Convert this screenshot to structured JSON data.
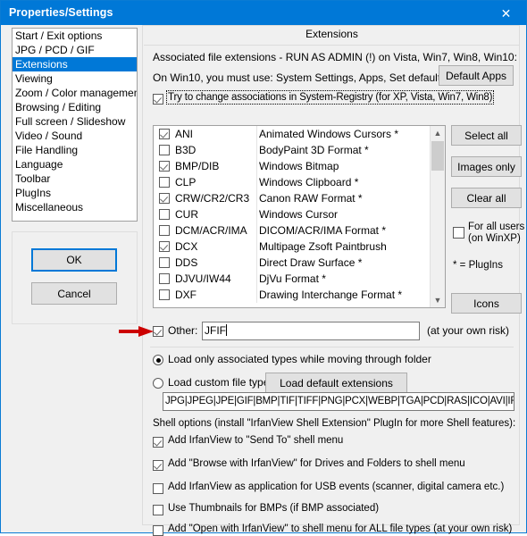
{
  "window": {
    "title": "Properties/Settings",
    "close_icon": "close-icon",
    "titlebar_color": "#0078d7",
    "accent_color": "#0078d7"
  },
  "sidebar": {
    "items": [
      {
        "label": "Start / Exit options",
        "selected": false
      },
      {
        "label": "JPG / PCD / GIF",
        "selected": false
      },
      {
        "label": "Extensions",
        "selected": true
      },
      {
        "label": "Viewing",
        "selected": false
      },
      {
        "label": "Zoom / Color management",
        "selected": false
      },
      {
        "label": "Browsing / Editing",
        "selected": false
      },
      {
        "label": "Full screen / Slideshow",
        "selected": false
      },
      {
        "label": "Video / Sound",
        "selected": false
      },
      {
        "label": "File Handling",
        "selected": false
      },
      {
        "label": "Language",
        "selected": false
      },
      {
        "label": "Toolbar",
        "selected": false
      },
      {
        "label": "PlugIns",
        "selected": false
      },
      {
        "label": "Miscellaneous",
        "selected": false
      }
    ],
    "buttons": {
      "ok": "OK",
      "cancel": "Cancel"
    }
  },
  "panel": {
    "group_title": "Extensions",
    "line1": "Associated file extensions - RUN AS ADMIN (!) on Vista, Win7, Win8, Win10:",
    "line2": "On Win10, you must use: System Settings, Apps, Set default apps !",
    "default_apps_button": "Default Apps",
    "registry_checkbox": {
      "label": "Try to change associations in System-Registry (for XP, Vista, Win7, Win8)",
      "checked": true
    },
    "side_buttons": {
      "select_all": "Select all",
      "images_only": "Images only",
      "clear_all": "Clear all",
      "icons": "Icons"
    },
    "all_users_checkbox": {
      "line1": "For all users",
      "line2": "(on WinXP)",
      "checked": false
    },
    "plugins_note": "* = PlugIns",
    "extensions": [
      {
        "ext": "ANI",
        "desc": "Animated Windows Cursors *",
        "checked": true
      },
      {
        "ext": "B3D",
        "desc": "BodyPaint 3D Format *",
        "checked": false
      },
      {
        "ext": "BMP/DIB",
        "desc": "Windows Bitmap",
        "checked": true
      },
      {
        "ext": "CLP",
        "desc": "Windows Clipboard *",
        "checked": false
      },
      {
        "ext": "CRW/CR2/CR3",
        "desc": "Canon RAW Format *",
        "checked": true
      },
      {
        "ext": "CUR",
        "desc": "Windows Cursor",
        "checked": false
      },
      {
        "ext": "DCM/ACR/IMA",
        "desc": "DICOM/ACR/IMA Format *",
        "checked": false
      },
      {
        "ext": "DCX",
        "desc": "Multipage Zsoft Paintbrush",
        "checked": true
      },
      {
        "ext": "DDS",
        "desc": "Direct Draw Surface *",
        "checked": false
      },
      {
        "ext": "DJVU/IW44",
        "desc": "DjVu Format *",
        "checked": false
      },
      {
        "ext": "DXF",
        "desc": "Drawing Interchange Format *",
        "checked": false
      }
    ],
    "scrollbar": {
      "up_icon": "chevron-up-icon",
      "down_icon": "chevron-down-icon"
    },
    "other_row": {
      "checkbox_label": "Other:",
      "checked": true,
      "value": "JFIF",
      "hint": "(at your own risk)"
    },
    "load_mode": {
      "option_associated": "Load only associated types while moving through folder",
      "option_custom": "Load custom file types:",
      "selected": "associated",
      "load_default_button": "Load default extensions",
      "custom_types_value": "JPG|JPEG|JPE|GIF|BMP|TIF|TIFF|PNG|PCX|WEBP|TGA|PCD|RAS|ICO|AVI|IFF|PBM"
    },
    "shell": {
      "header": "Shell options (install \"IrfanView Shell Extension\" PlugIn for more Shell features):",
      "options": [
        {
          "label": "Add IrfanView to \"Send To\" shell menu",
          "checked": true
        },
        {
          "label": "Add \"Browse with IrfanView\" for Drives and Folders to shell menu",
          "checked": true
        },
        {
          "label": "Add IrfanView as application for USB events (scanner, digital camera etc.)",
          "checked": false
        },
        {
          "label": "Use Thumbnails for BMPs (if BMP associated)",
          "checked": false
        },
        {
          "label": "Add \"Open with IrfanView\" to shell menu for ALL file types (at your own risk)",
          "checked": false
        }
      ]
    }
  },
  "annotation": {
    "arrow_color": "#cc0000",
    "arrow_name": "red-arrow-pointing-to-other-checkbox"
  }
}
